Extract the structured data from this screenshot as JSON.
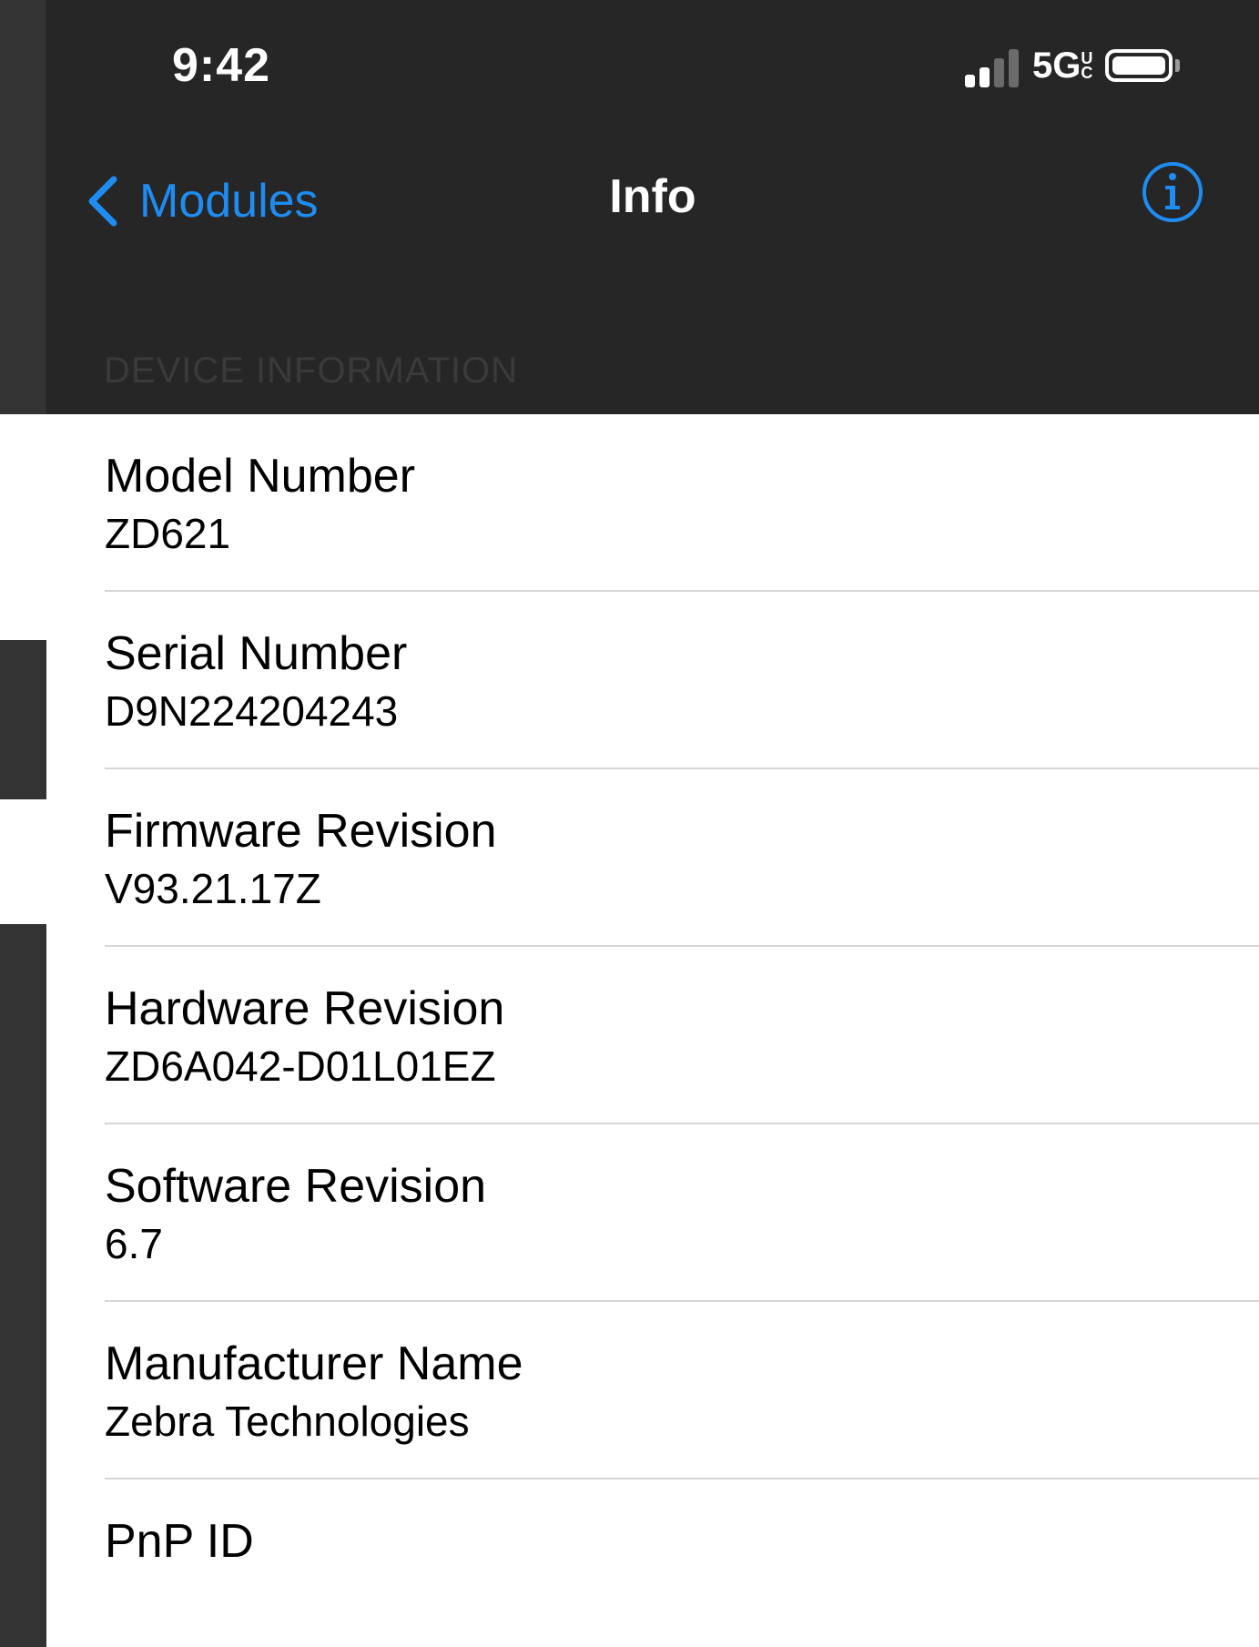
{
  "status_bar": {
    "time": "9:42",
    "network": "5G",
    "network_suffix": "UC"
  },
  "nav": {
    "back_label": "Modules",
    "title": "Info",
    "accent_color": "#1e8cf0"
  },
  "section": {
    "header": "DEVICE INFORMATION"
  },
  "rows": [
    {
      "title": "Model Number",
      "value": "ZD621"
    },
    {
      "title": "Serial Number",
      "value": "D9N224204243"
    },
    {
      "title": "Firmware Revision",
      "value": "V93.21.17Z"
    },
    {
      "title": "Hardware Revision",
      "value": "ZD6A042-D01L01EZ"
    },
    {
      "title": "Software Revision",
      "value": "6.7"
    },
    {
      "title": "Manufacturer Name",
      "value": "Zebra Technologies"
    },
    {
      "title": "PnP ID",
      "value": ""
    }
  ]
}
